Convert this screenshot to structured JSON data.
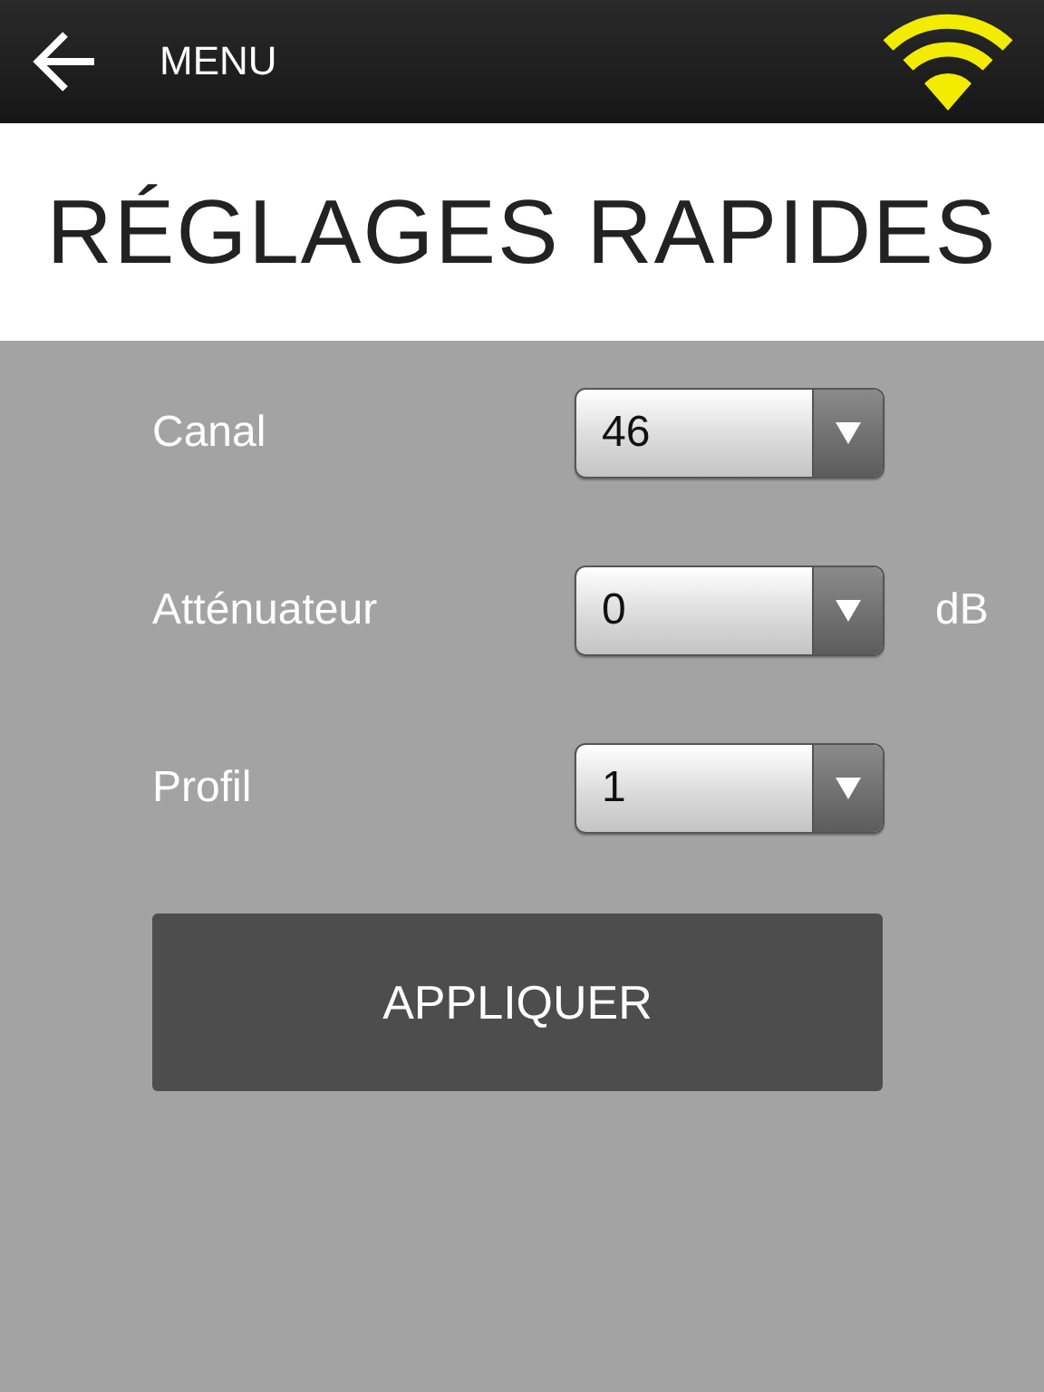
{
  "top_bar": {
    "menu_label": "MENU"
  },
  "title": "RÉGLAGES RAPIDES",
  "settings": [
    {
      "label": "Canal",
      "value": "46"
    },
    {
      "label": "Atténuateur",
      "value": "0",
      "unit": "dB"
    },
    {
      "label": "Profil",
      "value": "1"
    }
  ],
  "apply_button": "APPLIQUER"
}
